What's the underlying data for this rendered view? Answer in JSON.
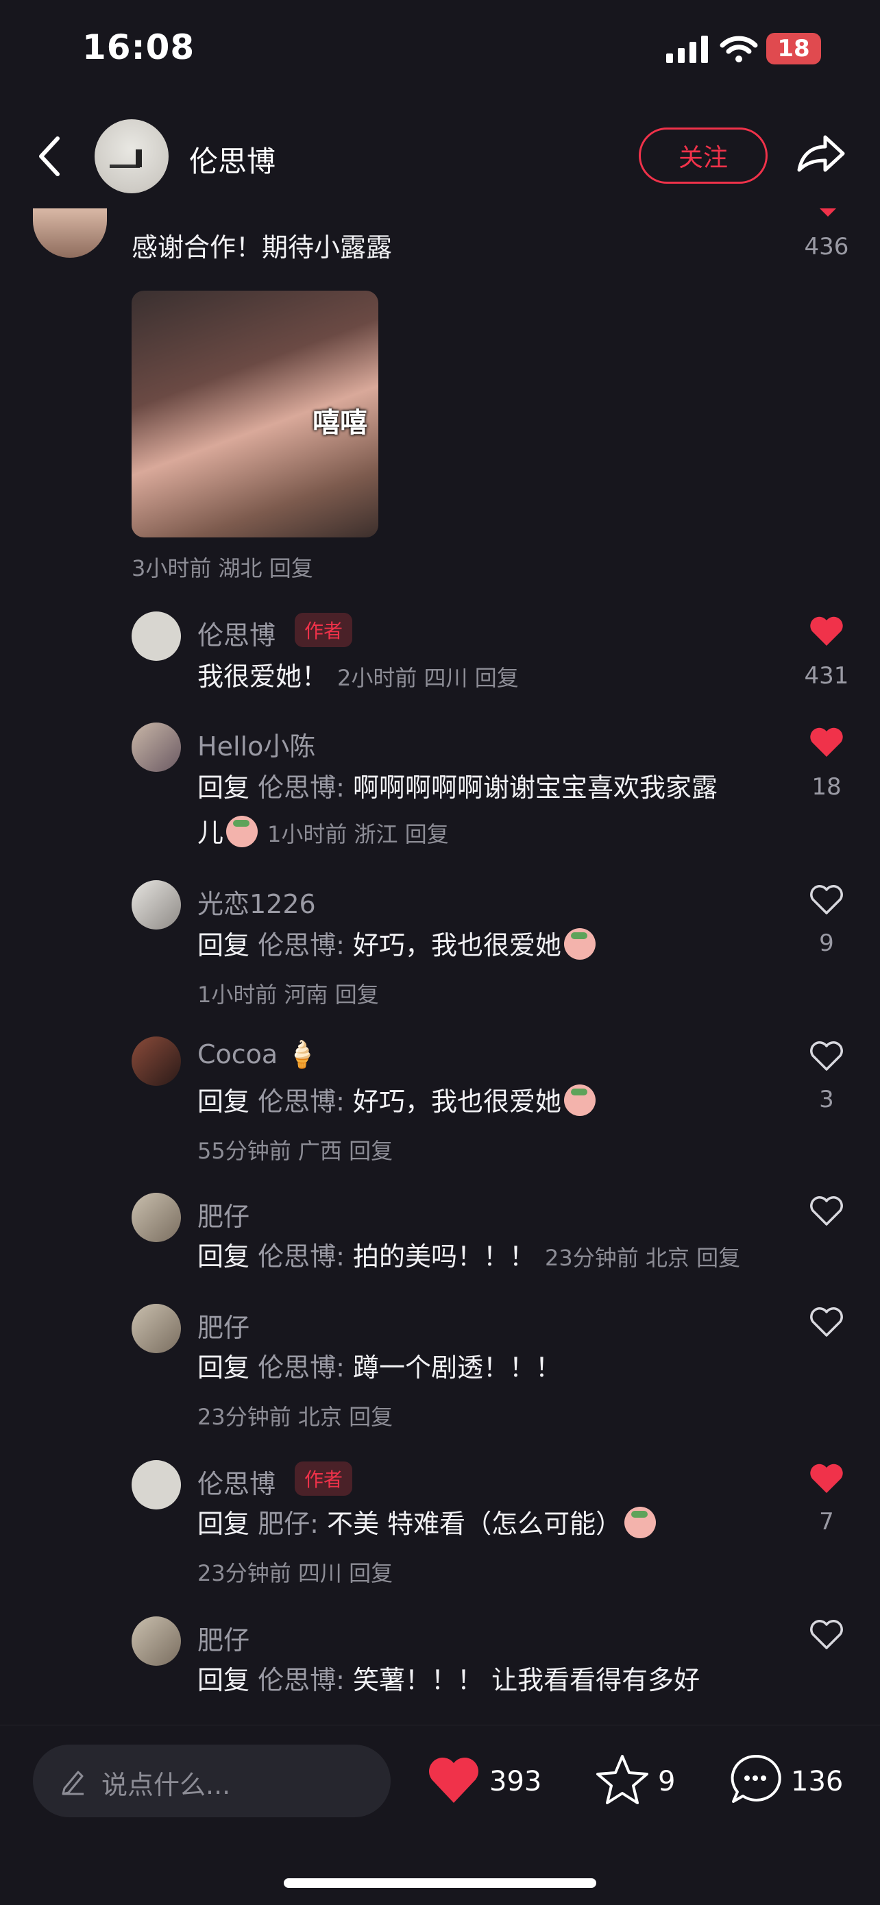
{
  "status": {
    "time": "16:08",
    "battery": "18"
  },
  "header": {
    "author": "伦思博",
    "follow_label": "关注"
  },
  "partial_comment": {
    "text": "感谢合作！期待小露露",
    "sticker_text": "嘻嘻",
    "meta": "3小时前 湖北 回复",
    "likes": "436"
  },
  "replies": [
    {
      "user": "伦思博",
      "tag": "作者",
      "text": "我很爱她！",
      "meta": "2小时前 四川 回复",
      "liked": true,
      "likes": "431"
    },
    {
      "user": "Hello小陈",
      "prefix": "回复",
      "target": "伦思博:",
      "text": "啊啊啊啊啊谢谢宝宝喜欢我家露",
      "text2": "儿",
      "meta": "1小时前 浙江 回复",
      "liked": true,
      "likes": "18"
    },
    {
      "user": "光恋1226",
      "prefix": "回复",
      "target": "伦思博:",
      "text": "好巧，我也很爱她",
      "meta": "1小时前 河南 回复",
      "liked": false,
      "likes": "9"
    },
    {
      "user": "Cocoa",
      "prefix": "回复",
      "target": "伦思博:",
      "text": "好巧，我也很爱她",
      "meta": "55分钟前 广西 回复",
      "liked": false,
      "likes": "3"
    },
    {
      "user": "肥仔",
      "prefix": "回复",
      "target": "伦思博:",
      "text": "拍的美吗！！！",
      "meta": "23分钟前 北京 回复",
      "liked": false,
      "likes": ""
    },
    {
      "user": "肥仔",
      "prefix": "回复",
      "target": "伦思博:",
      "text": "蹲一个剧透！！！",
      "meta": "23分钟前 北京 回复",
      "liked": false,
      "likes": ""
    },
    {
      "user": "伦思博",
      "tag": "作者",
      "prefix": "回复",
      "target": "肥仔:",
      "text": "不美 特难看（怎么可能）",
      "meta": "23分钟前 四川 回复",
      "liked": true,
      "likes": "7"
    },
    {
      "user": "肥仔",
      "prefix": "回复",
      "target": "伦思博:",
      "text": "笑薯！！！ 让我看看得有多好",
      "meta": "",
      "liked": false,
      "likes": ""
    }
  ],
  "bottom": {
    "placeholder": "说点什么...",
    "likes": "393",
    "favorites": "9",
    "comments": "136"
  },
  "colors": {
    "accent": "#f0324a",
    "background": "#17161d"
  }
}
